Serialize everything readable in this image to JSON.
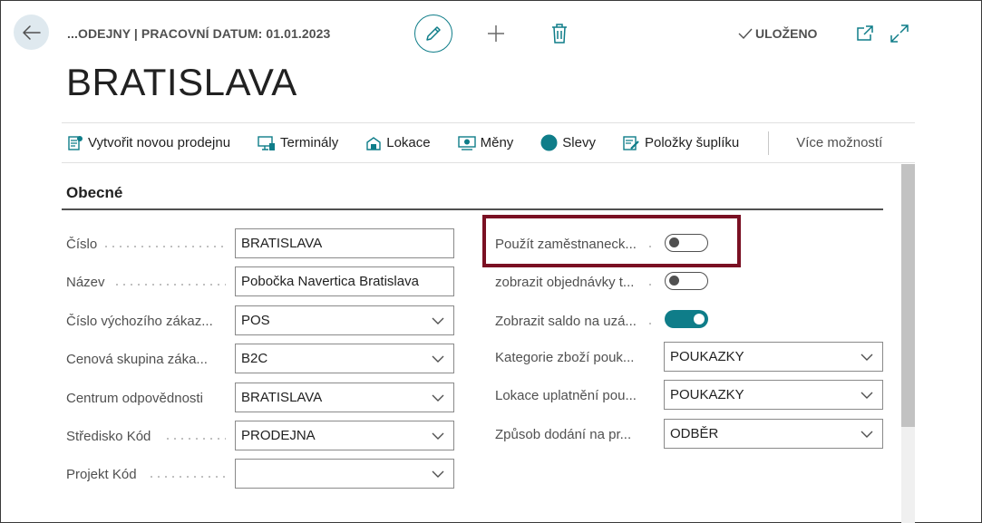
{
  "header": {
    "breadcrumb": "...ODEJNY | PRACOVNÍ DATUM: 01.01.2023",
    "saved_label": "ULOŽENO",
    "icons": [
      "back-arrow-icon",
      "pencil-icon",
      "plus-icon",
      "trash-icon",
      "check-icon",
      "popout-icon",
      "expand-icon"
    ]
  },
  "page": {
    "title": "BRATISLAVA"
  },
  "actions": {
    "new_store": "Vytvořit novou prodejnu",
    "terminals": "Terminály",
    "locations": "Lokace",
    "currencies": "Měny",
    "discounts": "Slevy",
    "drawer_items": "Položky šuplíku",
    "more": "Více možností"
  },
  "section": {
    "title": "Obecné"
  },
  "left_fields": {
    "number": {
      "label": "Číslo",
      "value": "BRATISLAVA"
    },
    "name": {
      "label": "Název",
      "value": "Pobočka Navertica Bratislava"
    },
    "default_customer": {
      "label": "Číslo výchozího zákaz...",
      "value": "POS"
    },
    "price_group": {
      "label": "Cenová skupina záka...",
      "value": "B2C"
    },
    "responsibility_center": {
      "label": "Centrum odpovědnosti",
      "value": "BRATISLAVA"
    },
    "department_code": {
      "label": "Středisko Kód",
      "value": "PRODEJNA"
    },
    "project_code": {
      "label": "Projekt Kód",
      "value": ""
    }
  },
  "right_fields": {
    "use_employee": {
      "label": "Použít zaměstnaneck...",
      "on": false
    },
    "show_orders": {
      "label": "zobrazit objednávky t...",
      "on": false
    },
    "show_balance": {
      "label": "Zobrazit saldo na uzá...",
      "on": true
    },
    "voucher_category": {
      "label": "Kategorie zboží pouk...",
      "value": "POUKAZKY"
    },
    "voucher_location": {
      "label": "Lokace uplatnění pou...",
      "value": "POUKAZKY"
    },
    "delivery_method": {
      "label": "Způsob dodání na pr...",
      "value": "ODBĚR"
    }
  },
  "colors": {
    "accent": "#0f7d89",
    "highlight": "#7a1023",
    "text": "#212121",
    "label": "#505050"
  }
}
